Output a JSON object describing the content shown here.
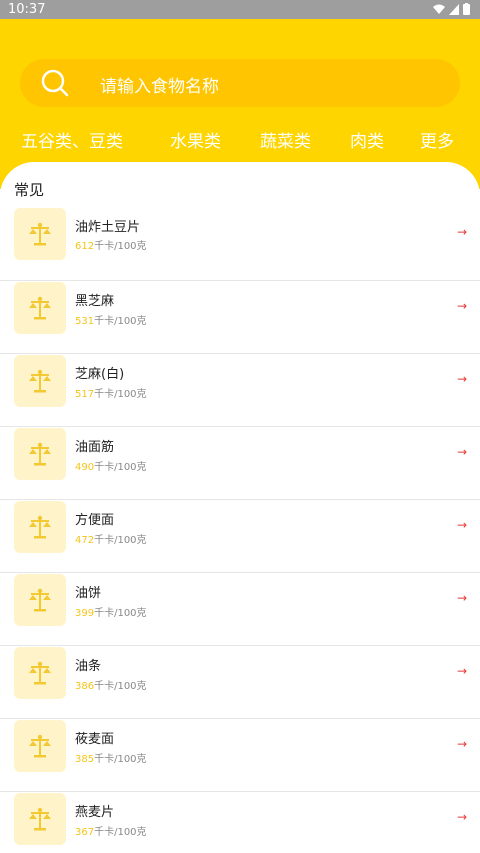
{
  "status_bar": {
    "time": "10:37"
  },
  "search": {
    "placeholder": "请输入食物名称"
  },
  "tabs": [
    "五谷类、豆类",
    "水果类",
    "蔬菜类",
    "肉类",
    "更多"
  ],
  "section_title": "常见",
  "unit_suffix": "千卡/100克",
  "items": [
    {
      "name": "油炸土豆片",
      "calories": "612"
    },
    {
      "name": "黑芝麻",
      "calories": "531"
    },
    {
      "name": "芝麻(白)",
      "calories": "517"
    },
    {
      "name": "油面筋",
      "calories": "490"
    },
    {
      "name": "方便面",
      "calories": "472"
    },
    {
      "name": "油饼",
      "calories": "399"
    },
    {
      "name": "油条",
      "calories": "386"
    },
    {
      "name": "莜麦面",
      "calories": "385"
    },
    {
      "name": "燕麦片",
      "calories": "367"
    }
  ],
  "colors": {
    "header": "#FFD500",
    "search_bg": "#FFC500",
    "accent": "#F5C518",
    "arrow": "#E53935",
    "thumb_bg": "#FFF4C9"
  },
  "icons": {
    "item_icon": "scale-icon",
    "arrow_icon": "arrow-right-icon"
  }
}
